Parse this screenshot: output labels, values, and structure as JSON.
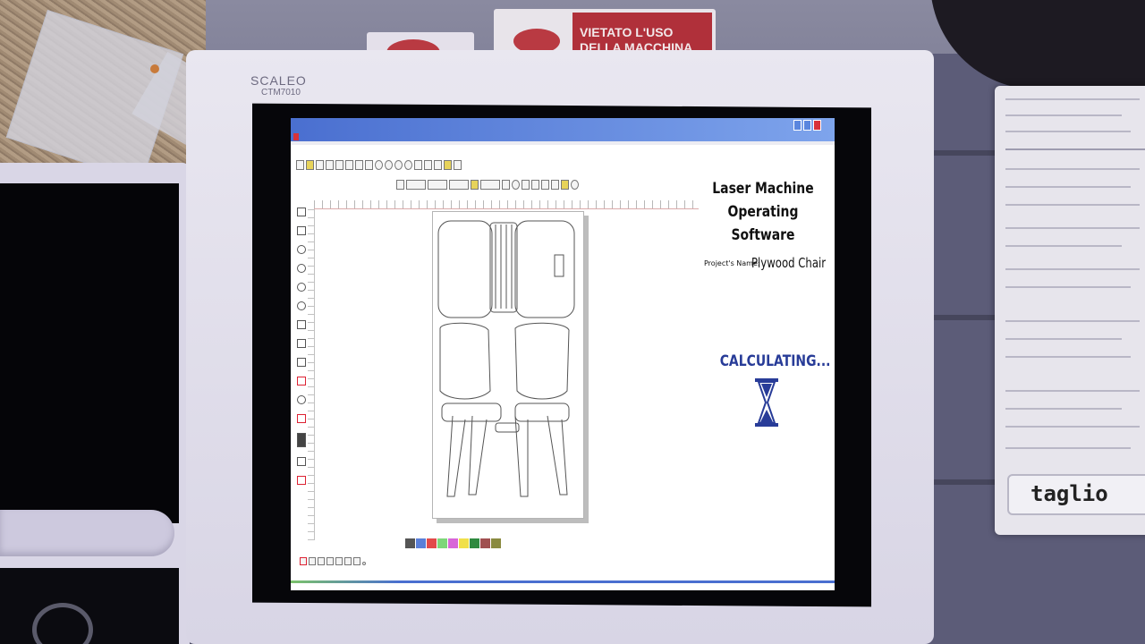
{
  "environment": {
    "sign_text": "VIETATO L'USO DELLA MACCHINA",
    "side_tag_text": "taglio"
  },
  "monitor": {
    "brand": "SCALEO",
    "model": "CTM7010"
  },
  "app": {
    "title_line1": "Laser Machine",
    "title_line2": "Operating Software",
    "project_label": "Project's Name:",
    "project_name": "Plywood Chair",
    "status": "CALCULATING...",
    "colors": {
      "titlebar": "#4a6fd0",
      "status": "#283c98",
      "hourglass": "#283c98"
    },
    "palette": [
      "#555555",
      "#5a7fd8",
      "#e24a4a",
      "#7ed67a",
      "#d866d8",
      "#f0e04a",
      "#2f8a3f",
      "#a05050",
      "#8a8a40"
    ],
    "window_icons": [
      "app-icon",
      "minimize-icon",
      "maximize-icon",
      "close-icon"
    ],
    "toolbar1_icons": [
      "new-file-icon",
      "open-folder-icon",
      "save-icon",
      "print-icon",
      "export-icon",
      "cut-icon",
      "copy-icon",
      "paste-icon",
      "undo-icon",
      "redo-icon",
      "zoom-in-icon",
      "zoom-out-icon",
      "delete-icon",
      "grid-icon",
      "layers-icon",
      "settings-icon",
      "help-icon"
    ],
    "toolbar2_icons": [
      "align-left-icon",
      "align-center-icon",
      "align-right-icon",
      "distribute-icon",
      "highlight-icon",
      "group-icon",
      "ungroup-icon",
      "rotate-icon",
      "mirror-icon",
      "table-icon",
      "node-icon",
      "frame-icon",
      "scale-icon",
      "info-icon"
    ],
    "left_tools": [
      "select-icon",
      "node-edit-icon",
      "circle-icon",
      "arc-icon",
      "ellipse-icon",
      "spiral-icon",
      "rectangle-icon",
      "text-icon",
      "pen-icon",
      "line-icon",
      "curve-icon",
      "color-bar-icon",
      "fill-icon",
      "eraser-icon",
      "hatch-icon"
    ],
    "bottom_tools": [
      "laser-icon",
      "list-icon",
      "position-icon",
      "align-bottom-icon",
      "step-icon",
      "cross-icon",
      "frame-run-icon",
      "dot-icon"
    ]
  }
}
